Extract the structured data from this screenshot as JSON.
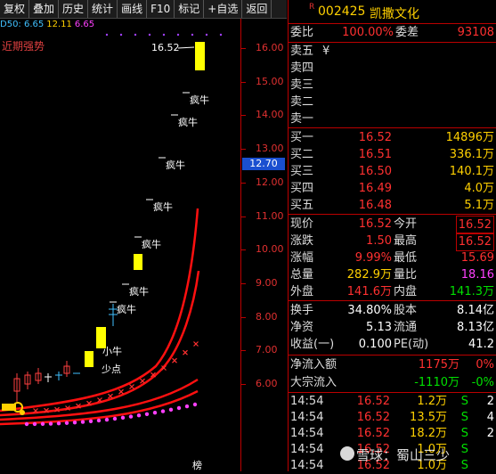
{
  "toolbar": [
    "复权",
    "叠加",
    "历史",
    "统计",
    "画线",
    "F10",
    "标记",
    "+自选",
    "返回"
  ],
  "ma_legend": [
    {
      "text": "D50: 6.65",
      "color": "#40c0ff"
    },
    {
      "text": "12.11",
      "color": "#ffd000"
    },
    {
      "text": "6.65",
      "color": "#ff40ff"
    }
  ],
  "indicator_label": "近期强势",
  "price_axis": {
    "ticks": [
      "16.00",
      "15.00",
      "14.00",
      "13.00",
      "12.00",
      "11.00",
      "10.00",
      "9.00",
      "8.00",
      "7.00",
      "6.00"
    ],
    "current": "12.70"
  },
  "chart_annotations": {
    "peak_price": "16.52",
    "crazy_bull": "疯牛",
    "small_bull": "小牛",
    "low_point": "少点",
    "bottom_label": "榜"
  },
  "stock": {
    "badge": "R",
    "code": "002425",
    "name": "凯撒文化"
  },
  "weibi": {
    "label1": "委比",
    "value1": "100.00%",
    "label2": "委差",
    "value2": "93108"
  },
  "sell_orders": [
    {
      "label": "卖五",
      "mark": "¥"
    },
    {
      "label": "卖四",
      "mark": ""
    },
    {
      "label": "卖三",
      "mark": ""
    },
    {
      "label": "卖二",
      "mark": ""
    },
    {
      "label": "卖一",
      "mark": ""
    }
  ],
  "buy_orders": [
    {
      "label": "买一",
      "price": "16.52",
      "volume": "14896万"
    },
    {
      "label": "买二",
      "price": "16.51",
      "volume": "336.1万"
    },
    {
      "label": "买三",
      "price": "16.50",
      "volume": "140.1万"
    },
    {
      "label": "买四",
      "price": "16.49",
      "volume": "4.0万"
    },
    {
      "label": "买五",
      "price": "16.48",
      "volume": "5.1万"
    }
  ],
  "quote": [
    {
      "l1": "现价",
      "v1": "16.52",
      "l2": "今开",
      "v2": "16.52",
      "c1": "red",
      "c2": "red",
      "box2": true
    },
    {
      "l1": "涨跌",
      "v1": "1.50",
      "l2": "最高",
      "v2": "16.52",
      "c1": "red",
      "c2": "red",
      "box2": true
    },
    {
      "l1": "涨幅",
      "v1": "9.99%",
      "l2": "最低",
      "v2": "15.69",
      "c1": "red",
      "c2": "red",
      "box2": false
    },
    {
      "l1": "总量",
      "v1": "282.9万",
      "l2": "量比",
      "v2": "18.16",
      "c1": "yel",
      "c2": "mag",
      "box2": false
    },
    {
      "l1": "外盘",
      "v1": "141.6万",
      "l2": "内盘",
      "v2": "141.3万",
      "c1": "red",
      "c2": "grn",
      "box2": false
    }
  ],
  "fundamentals": [
    {
      "l1": "换手",
      "v1": "34.80%",
      "l2": "股本",
      "v2": "8.14亿"
    },
    {
      "l1": "净资",
      "v1": "5.13",
      "l2": "流通",
      "v2": "8.13亿"
    },
    {
      "l1": "收益(一)",
      "v1": "0.100",
      "l2": "PE(动)",
      "v2": "41.2"
    }
  ],
  "flows": [
    {
      "label": "净流入额",
      "value": "1175万",
      "pct": "0%",
      "vc": "red",
      "pc": "red"
    },
    {
      "label": "大宗流入",
      "value": "-1110万",
      "pct": "-0%",
      "vc": "grn",
      "pc": "grn"
    }
  ],
  "trades": [
    {
      "time": "14:54",
      "price": "16.52",
      "vol": "1.2万",
      "side": "S",
      "n": "2"
    },
    {
      "time": "14:54",
      "price": "16.52",
      "vol": "13.5万",
      "side": "S",
      "n": "4"
    },
    {
      "time": "14:54",
      "price": "16.52",
      "vol": "18.2万",
      "side": "S",
      "n": "2"
    },
    {
      "time": "14:54",
      "price": "16.52",
      "vol": "1.0万",
      "side": "S",
      "n": ""
    },
    {
      "time": "14:54",
      "price": "16.52",
      "vol": "1.0万",
      "side": "S",
      "n": ""
    }
  ],
  "watermark": "雪球：蜀山三少",
  "colors": {
    "up": "#ff3030",
    "down": "#00e000",
    "yellow": "#ffd000",
    "accent": "#1a4fd0"
  }
}
